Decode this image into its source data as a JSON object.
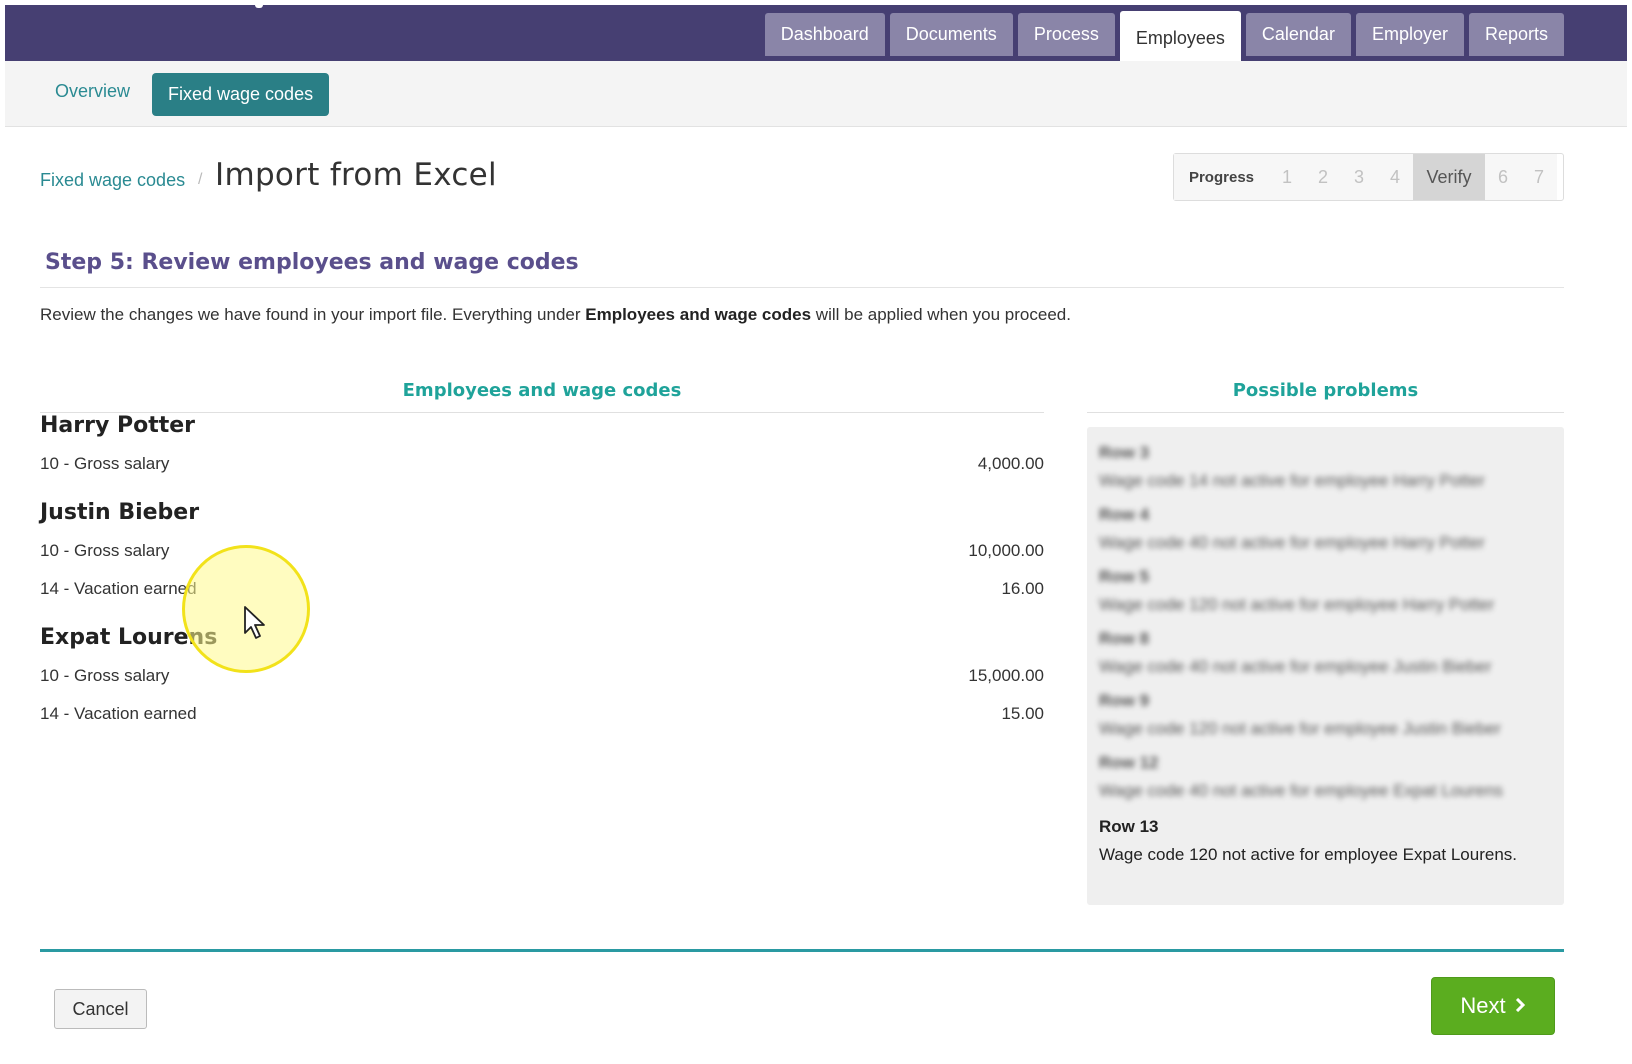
{
  "nav": {
    "tabs": [
      {
        "label": "Dashboard",
        "active": false
      },
      {
        "label": "Documents",
        "active": false
      },
      {
        "label": "Process",
        "active": false
      },
      {
        "label": "Employees",
        "active": true
      },
      {
        "label": "Calendar",
        "active": false
      },
      {
        "label": "Employer",
        "active": false
      },
      {
        "label": "Reports",
        "active": false
      }
    ]
  },
  "subnav": {
    "overview": "Overview",
    "fixed_wage_codes": "Fixed wage codes"
  },
  "header": {
    "breadcrumb": "Fixed wage codes",
    "separator": "/",
    "title": "Import from Excel"
  },
  "progress": {
    "label": "Progress",
    "steps": [
      "1",
      "2",
      "3",
      "4",
      "Verify",
      "6",
      "7"
    ],
    "current": "Verify"
  },
  "step": {
    "title": "Step 5: Review employees and wage codes",
    "desc_before": "Review the changes we have found in your import file. Everything under ",
    "desc_bold": "Employees and wage codes",
    "desc_after": " will be applied when you proceed."
  },
  "employees_column": {
    "heading": "Employees and wage codes",
    "employees": [
      {
        "name": "Harry Potter",
        "codes": [
          {
            "label": "10 - Gross salary",
            "value": "4,000.00"
          }
        ]
      },
      {
        "name": "Justin Bieber",
        "codes": [
          {
            "label": "10 - Gross salary",
            "value": "10,000.00"
          },
          {
            "label": "14 - Vacation earned",
            "value": "16.00"
          }
        ]
      },
      {
        "name": "Expat Lourens",
        "codes": [
          {
            "label": "10 - Gross salary",
            "value": "15,000.00"
          },
          {
            "label": "14 - Vacation earned",
            "value": "15.00"
          }
        ]
      }
    ]
  },
  "problems_column": {
    "heading": "Possible problems",
    "problems": [
      {
        "row": "Row 3",
        "message": "Wage code 14 not active for employee Harry Potter",
        "blurred": true
      },
      {
        "row": "Row 4",
        "message": "Wage code 40 not active for employee Harry Potter",
        "blurred": true
      },
      {
        "row": "Row 5",
        "message": "Wage code 120 not active for employee Harry Potter",
        "blurred": true
      },
      {
        "row": "Row 8",
        "message": "Wage code 40 not active for employee Justin Bieber",
        "blurred": true
      },
      {
        "row": "Row 9",
        "message": "Wage code 120 not active for employee Justin Bieber",
        "blurred": true
      },
      {
        "row": "Row 12",
        "message": "Wage code 40 not active for employee Expat Lourens",
        "blurred": true
      },
      {
        "row": "Row 13",
        "message": "Wage code 120 not active for employee Expat Lourens.",
        "blurred": false
      }
    ]
  },
  "footer": {
    "cancel": "Cancel",
    "next": "Next"
  },
  "colors": {
    "nav_bg": "#463f72",
    "teal": "#2a7f86",
    "accent_green": "#5bad1f",
    "heading_teal": "#1fa39a",
    "step_purple": "#5a4f8c"
  },
  "icons": {
    "next_chevron": "chevron-right-icon",
    "cursor": "mouse-pointer-icon"
  }
}
